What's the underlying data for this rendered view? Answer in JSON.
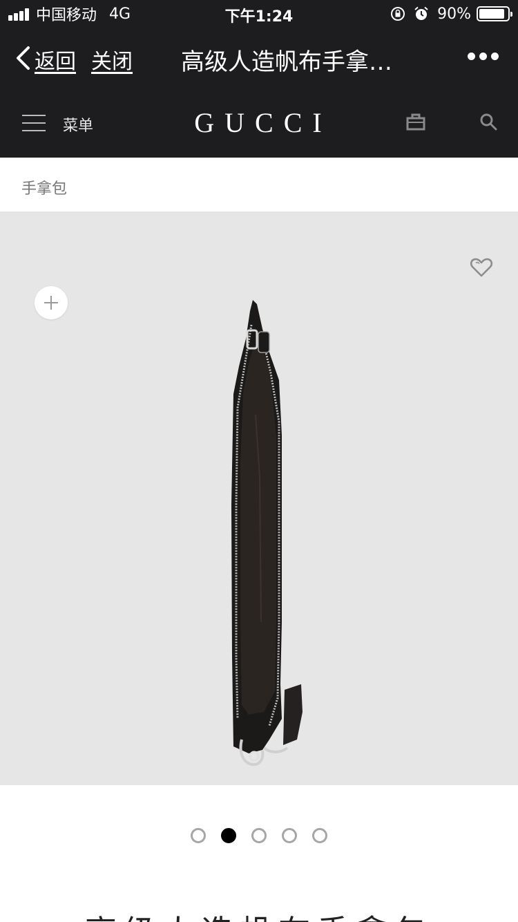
{
  "status_bar": {
    "carrier": "中国移动",
    "network": "4G",
    "time": "下午1:24",
    "battery": "90%",
    "battery_level": 0.9
  },
  "nav": {
    "back_label": "返回",
    "close_label": "关闭",
    "title": "高级人造帆布手拿…",
    "more_icon": "more-dots-icon"
  },
  "site_header": {
    "menu_label": "菜单",
    "logo": "GUCCI",
    "icons": [
      "menu-icon",
      "shopping-bag-icon",
      "search-icon"
    ]
  },
  "breadcrumb": {
    "label": "手拿包"
  },
  "product": {
    "title": "高级人造帆布手拿包",
    "icons": [
      "heart-icon",
      "zoom-plus-icon"
    ]
  },
  "carousel": {
    "total": 5,
    "active_index": 2
  },
  "colors": {
    "header_bg": "#1d1d1f",
    "stage_bg": "#e6e6e6",
    "dot_active": "#000000",
    "dot_inactive": "#a6a6a6"
  }
}
